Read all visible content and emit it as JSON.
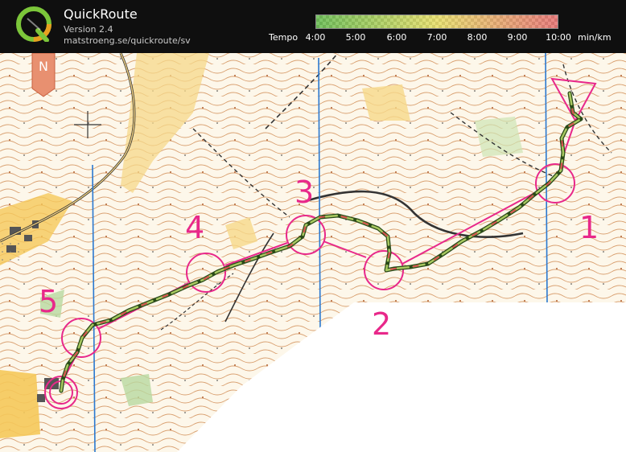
{
  "app": {
    "title": "QuickRoute",
    "version": "Version 2.4",
    "url": "matstroeng.se/quickroute/sv",
    "logo_letter": "Q"
  },
  "tempo": {
    "label": "Tempo",
    "ticks": [
      "4:00",
      "5:00",
      "6:00",
      "7:00",
      "8:00",
      "9:00",
      "10:00"
    ],
    "unit": "min/km",
    "color_start": "#6fbf5a",
    "color_mid": "#e8e070",
    "color_end": "#e87a7a"
  },
  "map": {
    "north_label": "N",
    "controls": [
      "1",
      "2",
      "3",
      "4",
      "5"
    ],
    "course_color": "#e8288a",
    "route_color": "#3a6a2a"
  }
}
